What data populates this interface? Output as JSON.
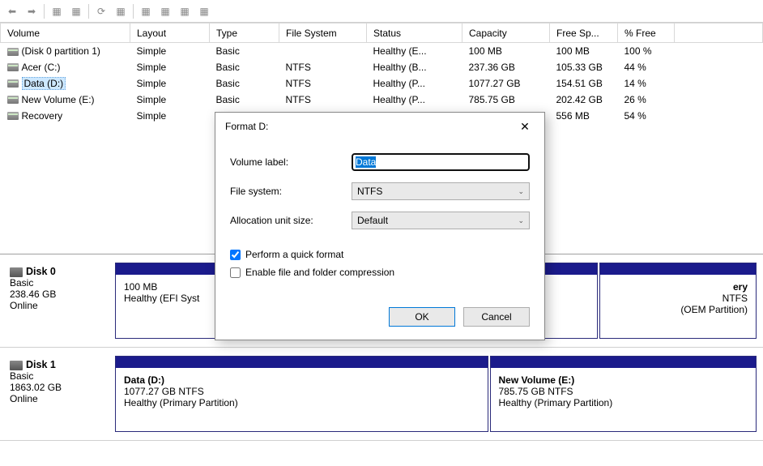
{
  "columns": [
    "Volume",
    "Layout",
    "Type",
    "File System",
    "Status",
    "Capacity",
    "Free Sp...",
    "% Free"
  ],
  "volumes": [
    {
      "name": "(Disk 0 partition 1)",
      "layout": "Simple",
      "type": "Basic",
      "fs": "",
      "status": "Healthy (E...",
      "cap": "100 MB",
      "free": "100 MB",
      "pct": "100 %",
      "selected": false
    },
    {
      "name": "Acer (C:)",
      "layout": "Simple",
      "type": "Basic",
      "fs": "NTFS",
      "status": "Healthy (B...",
      "cap": "237.36 GB",
      "free": "105.33 GB",
      "pct": "44 %",
      "selected": false
    },
    {
      "name": "Data (D:)",
      "layout": "Simple",
      "type": "Basic",
      "fs": "NTFS",
      "status": "Healthy (P...",
      "cap": "1077.27 GB",
      "free": "154.51 GB",
      "pct": "14 %",
      "selected": true
    },
    {
      "name": "New Volume (E:)",
      "layout": "Simple",
      "type": "Basic",
      "fs": "NTFS",
      "status": "Healthy (P...",
      "cap": "785.75 GB",
      "free": "202.42 GB",
      "pct": "26 %",
      "selected": false
    },
    {
      "name": "Recovery",
      "layout": "Simple",
      "type": "",
      "fs": "",
      "status": "",
      "cap": "",
      "free": "556 MB",
      "pct": "54 %",
      "selected": false
    }
  ],
  "disks": [
    {
      "name": "Disk 0",
      "type": "Basic",
      "size": "238.46 GB",
      "state": "Online",
      "parts": [
        {
          "title": "",
          "line2": "100 MB",
          "line3": "Healthy (EFI Syst",
          "flex": 1
        },
        {
          "title": "",
          "line2": "",
          "line3": "",
          "flex": 3.0,
          "hidden_by_dialog": true
        },
        {
          "title": "ery",
          "line2": "NTFS",
          "line3": "(OEM Partition)",
          "flex": 1.3,
          "right_edge": true
        }
      ]
    },
    {
      "name": "Disk 1",
      "type": "Basic",
      "size": "1863.02 GB",
      "state": "Online",
      "parts": [
        {
          "title": "Data  (D:)",
          "line2": "1077.27 GB NTFS",
          "line3": "Healthy (Primary Partition)",
          "flex": 1.4
        },
        {
          "title": "New Volume  (E:)",
          "line2": "785.75 GB NTFS",
          "line3": "Healthy (Primary Partition)",
          "flex": 1.0
        }
      ]
    }
  ],
  "dialog": {
    "title": "Format D:",
    "volume_label_lbl": "Volume label:",
    "volume_label_val": "Data",
    "fs_lbl": "File system:",
    "fs_val": "NTFS",
    "aus_lbl": "Allocation unit size:",
    "aus_val": "Default",
    "quick_lbl": "Perform a quick format",
    "quick_checked": true,
    "compress_lbl": "Enable file and folder compression",
    "compress_checked": false,
    "ok": "OK",
    "cancel": "Cancel"
  }
}
